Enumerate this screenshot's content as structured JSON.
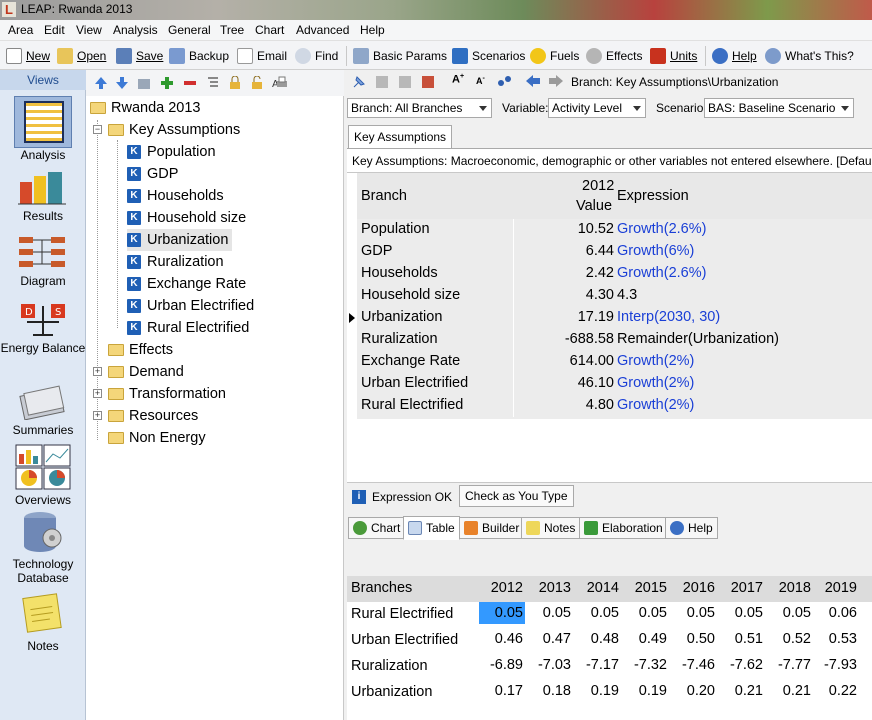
{
  "window": {
    "title": "LEAP: Rwanda 2013",
    "logo_letter": "L"
  },
  "menu": [
    "Area",
    "Edit",
    "View",
    "Analysis",
    "General",
    "Tree",
    "Chart",
    "Advanced",
    "Help"
  ],
  "toolbar": {
    "new": "New",
    "open": "Open",
    "save": "Save",
    "backup": "Backup",
    "email": "Email",
    "find": "Find",
    "basic_params": "Basic Params",
    "scenarios": "Scenarios",
    "fuels": "Fuels",
    "effects": "Effects",
    "units": "Units",
    "help": "Help",
    "whats_this": "What's This?"
  },
  "views": {
    "header": "Views",
    "items": [
      {
        "label": "Analysis",
        "icon": "analysis-icon"
      },
      {
        "label": "Results",
        "icon": "results-icon"
      },
      {
        "label": "Diagram",
        "icon": "diagram-icon"
      },
      {
        "label": "Energy Balance",
        "icon": "energy-balance-icon"
      },
      {
        "label": "Summaries",
        "icon": "summaries-icon"
      },
      {
        "label": "Overviews",
        "icon": "overviews-icon"
      },
      {
        "label": "Technology Database",
        "icon": "technology-database-icon"
      },
      {
        "label": "Notes",
        "icon": "notes-icon"
      }
    ]
  },
  "tree": {
    "root": "Rwanda 2013",
    "key_assumptions": "Key Assumptions",
    "key_items": [
      "Population",
      "GDP",
      "Households",
      "Household size",
      "Urbanization",
      "Ruralization",
      "Exchange Rate",
      "Urban Electrified",
      "Rural Electrified"
    ],
    "key_icon_letter": "K",
    "others": [
      "Effects",
      "Demand",
      "Transformation",
      "Resources",
      "Non Energy"
    ]
  },
  "branch_bar": {
    "branch_path": "Branch: Key Assumptions\\Urbanization"
  },
  "filters": {
    "branch_label": "Branch:",
    "branch_value": "All Branches",
    "variable_label": "Variable:",
    "variable_value": "Activity Level",
    "scenario_label": "Scenario:",
    "scenario_value": "BAS: Baseline Scenario"
  },
  "expr_tab": "Key Assumptions",
  "description": "Key Assumptions: Macroeconomic, demographic or other variables not entered elsewhere. [Defaul",
  "expr_table": {
    "col_branch": "Branch",
    "col_year": "2012",
    "col_value": "Value",
    "col_expr": "Expression",
    "rows": [
      {
        "name": "Population",
        "value": "10.52",
        "expr": "Growth(2.6%)",
        "blue": true
      },
      {
        "name": "GDP",
        "value": "6.44",
        "expr": "Growth(6%)",
        "blue": true
      },
      {
        "name": "Households",
        "value": "2.42",
        "expr": "Growth(2.6%)",
        "blue": true
      },
      {
        "name": "Household size",
        "value": "4.30",
        "expr": "4.3",
        "blue": false
      },
      {
        "name": "Urbanization",
        "value": "17.19",
        "expr": "Interp(2030, 30)",
        "blue": true
      },
      {
        "name": "Ruralization",
        "value": "-688.58",
        "expr": "Remainder(Urbanization)",
        "blue": false
      },
      {
        "name": "Exchange Rate",
        "value": "614.00",
        "expr": "Growth(2%)",
        "blue": true
      },
      {
        "name": "Urban Electrified",
        "value": "46.10",
        "expr": "Growth(2%)",
        "blue": true
      },
      {
        "name": "Rural Electrified",
        "value": "4.80",
        "expr": "Growth(2%)",
        "blue": true
      }
    ]
  },
  "status": {
    "expression_ok": "Expression OK",
    "check_as_you_type": "Check as You Type"
  },
  "bottom_tabs": [
    "Chart",
    "Table",
    "Builder",
    "Notes",
    "Elaboration",
    "Help"
  ],
  "data_table": {
    "col_branches": "Branches",
    "years": [
      "2012",
      "2013",
      "2014",
      "2015",
      "2016",
      "2017",
      "2018",
      "2019"
    ],
    "rows": [
      {
        "name": "Rural Electrified",
        "values": [
          "0.05",
          "0.05",
          "0.05",
          "0.05",
          "0.05",
          "0.05",
          "0.05",
          "0.06"
        ]
      },
      {
        "name": "Urban Electrified",
        "values": [
          "0.46",
          "0.47",
          "0.48",
          "0.49",
          "0.50",
          "0.51",
          "0.52",
          "0.53"
        ]
      },
      {
        "name": "Ruralization",
        "values": [
          "-6.89",
          "-7.03",
          "-7.17",
          "-7.32",
          "-7.46",
          "-7.62",
          "-7.77",
          "-7.93"
        ]
      },
      {
        "name": "Urbanization",
        "values": [
          "0.17",
          "0.18",
          "0.19",
          "0.19",
          "0.20",
          "0.21",
          "0.21",
          "0.22"
        ]
      }
    ]
  },
  "colors": {
    "accent": "#1f5fb5",
    "expression_blue": "#1a3fd6",
    "selected_cell": "#3399ff"
  }
}
